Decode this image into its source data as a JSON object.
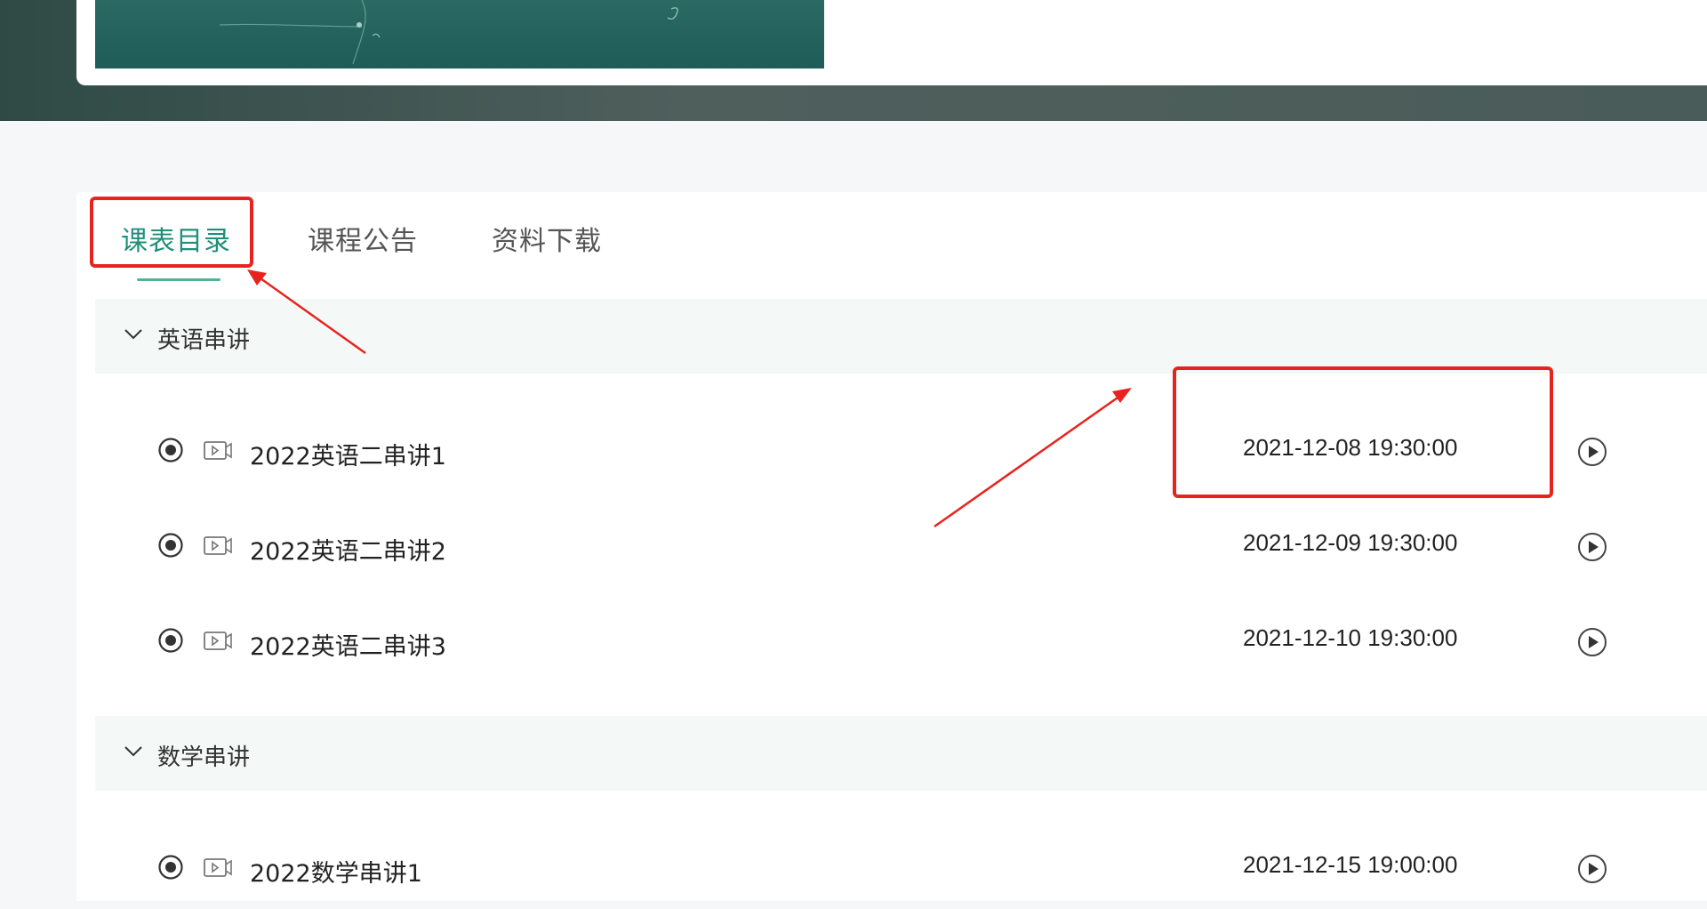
{
  "tabs": [
    {
      "label": "课表目录",
      "active": true
    },
    {
      "label": "课程公告",
      "active": false
    },
    {
      "label": "资料下载",
      "active": false
    }
  ],
  "sections": [
    {
      "title": "英语串讲",
      "expanded": true,
      "lessons": [
        {
          "title": "2022英语二串讲1",
          "time": "2021-12-08 19:30:00"
        },
        {
          "title": "2022英语二串讲2",
          "time": "2021-12-09 19:30:00"
        },
        {
          "title": "2022英语二串讲3",
          "time": "2021-12-10 19:30:00"
        }
      ]
    },
    {
      "title": "数学串讲",
      "expanded": true,
      "lessons": [
        {
          "title": "2022数学串讲1",
          "time": "2021-12-15 19:00:00"
        }
      ]
    }
  ],
  "icons": {
    "section_toggle": "chevron-down-icon",
    "lesson_status": "radio-selected-icon",
    "lesson_type": "video-icon",
    "lesson_action": "play-circle-icon"
  },
  "colors": {
    "accent": "#1f8f7a",
    "tab_underline": "#4fb394",
    "annotation": "#e8231f",
    "section_bg": "#f4f8f7"
  }
}
